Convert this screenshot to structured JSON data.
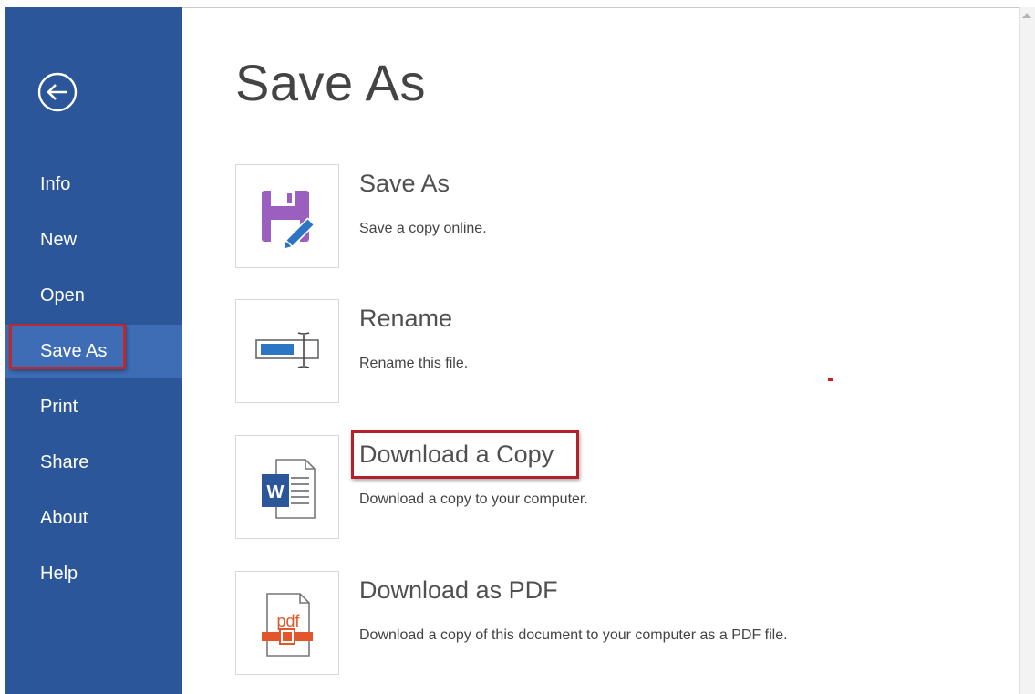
{
  "sidebar": {
    "back_icon": "back-arrow-icon",
    "items": [
      {
        "label": "Info",
        "selected": false
      },
      {
        "label": "New",
        "selected": false
      },
      {
        "label": "Open",
        "selected": false
      },
      {
        "label": "Save As",
        "selected": true
      },
      {
        "label": "Print",
        "selected": false
      },
      {
        "label": "Share",
        "selected": false
      },
      {
        "label": "About",
        "selected": false
      },
      {
        "label": "Help",
        "selected": false
      }
    ]
  },
  "main": {
    "title": "Save As",
    "options": [
      {
        "title": "Save As",
        "description": "Save a copy online.",
        "icon": "save-floppy-pencil-icon"
      },
      {
        "title": "Rename",
        "description": "Rename this file.",
        "icon": "rename-textbox-icon"
      },
      {
        "title": "Download a Copy",
        "description": "Download a copy to your computer.",
        "icon": "word-document-icon"
      },
      {
        "title": "Download as PDF",
        "description": "Download a copy of this document to your computer as a PDF file.",
        "icon": "pdf-file-icon"
      }
    ]
  },
  "colors": {
    "sidebar": "#2b579a",
    "sidebar_selected": "#3e6db5",
    "annotation_red": "#c0272d",
    "save_icon_purple": "#9a5fbf",
    "rename_icon_blue": "#2b75c4",
    "word_blue": "#2b579a",
    "pdf_orange": "#e2562a"
  }
}
